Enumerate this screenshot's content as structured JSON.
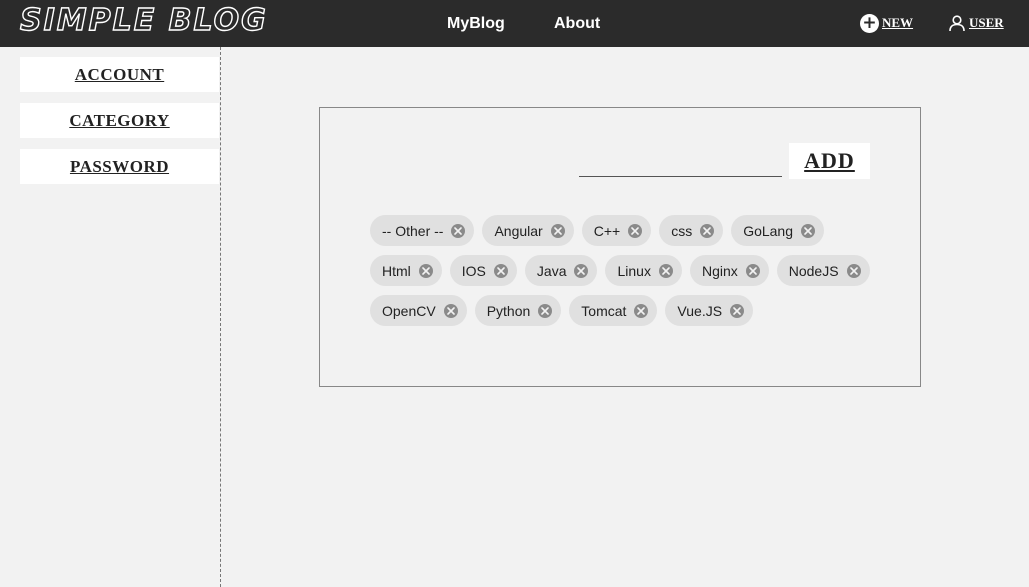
{
  "header": {
    "brand": "SIMPLE BLOG",
    "nav": [
      {
        "label": "MyBlog"
      },
      {
        "label": "About"
      }
    ],
    "new_label": "NEW",
    "user_label": "USER"
  },
  "sidebar": {
    "items": [
      {
        "label": "ACCOUNT"
      },
      {
        "label": "CATEGORY"
      },
      {
        "label": "PASSWORD"
      }
    ]
  },
  "category_panel": {
    "input_value": "",
    "add_label": "ADD",
    "tags": [
      "-- Other --",
      "Angular",
      "C++",
      "css",
      "GoLang",
      "Html",
      "IOS",
      "Java",
      "Linux",
      "Nginx",
      "NodeJS",
      "OpenCV",
      "Python",
      "Tomcat",
      "Vue.JS"
    ]
  },
  "colors": {
    "topbar": "#2b2b2b",
    "background": "#f2f2f2",
    "tag": "#e0e0e0",
    "tag_close": "#8a8a8a"
  }
}
